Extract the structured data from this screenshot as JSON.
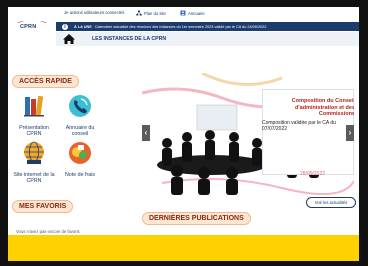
{
  "logo": {
    "text": "CPRN",
    "sub": ""
  },
  "topbar": {
    "connect_link": "Je actions utilisateurs connectés",
    "sitemap_link": "Plan du site",
    "contact_link": "Annuaire"
  },
  "announcement": {
    "label": "À LA UNE",
    "text": "Calendrier actualisé des réunions des instances du 1er semestre 2023 validé par le CA du 24/09/2022"
  },
  "nav": {
    "items": [
      {
        "label": "LES INSTANCES DE LA CPRN"
      }
    ]
  },
  "quick_access": {
    "title": "ACCÈS RAPIDE",
    "items": [
      {
        "label": "Présentation CPRN"
      },
      {
        "label": "Annuaire du conseil"
      },
      {
        "label": "Site internet de la CPRN"
      },
      {
        "label": "Note de frais"
      }
    ]
  },
  "carousel": {
    "slide_title": "Composition du Conseil d'administration et des Commissions",
    "slide_desc": "Composition validée par le CA du 07/07/2022",
    "slide_date": "28/09/2022",
    "news_button": "Voir les actualités"
  },
  "favorites": {
    "title": "MES FAVORIS",
    "empty_text": "Vous n'avez pas encore de favoris"
  },
  "publications": {
    "title": "DERNIÈRES PUBLICATIONS"
  },
  "colors": {
    "navy": "#1d3c6e",
    "accent_red": "#b0251a",
    "pill_bg": "#fde6d3",
    "yellow": "#ffd100"
  }
}
